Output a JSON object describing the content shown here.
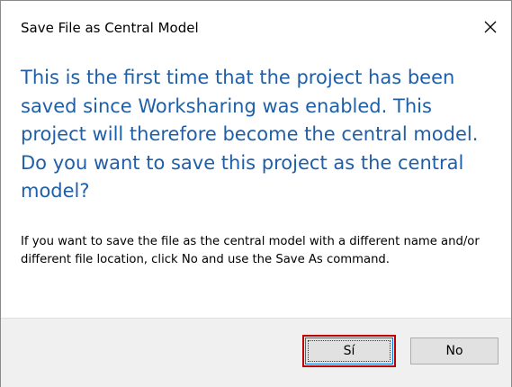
{
  "dialog": {
    "title": "Save File as Central Model",
    "close_icon": "close-icon",
    "main_instruction": "This is the first time that the project has been saved since Worksharing was enabled. This project will therefore become the central model. Do you want to save this project as the central model?",
    "detail": "If you want to save the file as the central model with a different name and/or different file location, click No and use the Save As command.",
    "buttons": {
      "yes_label": "Sí",
      "no_label": "No"
    }
  },
  "colors": {
    "instruction_text": "#1f5fa8",
    "footer_background": "#f0f0f0",
    "focus_border": "#0078d7",
    "highlight_outline": "#c00000"
  }
}
